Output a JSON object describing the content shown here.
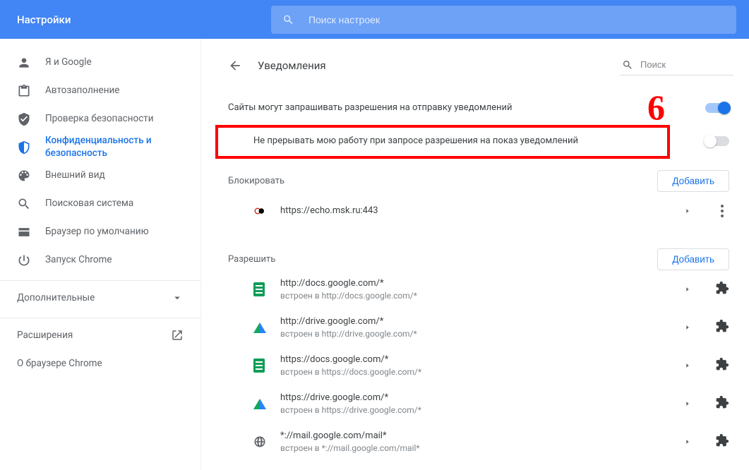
{
  "header": {
    "title": "Настройки",
    "search_placeholder": "Поиск настроек"
  },
  "sidebar": {
    "items": [
      {
        "label": "Я и Google"
      },
      {
        "label": "Автозаполнение"
      },
      {
        "label": "Проверка безопасности"
      },
      {
        "label": "Конфиденциальность и безопасность"
      },
      {
        "label": "Внешний вид"
      },
      {
        "label": "Поисковая система"
      },
      {
        "label": "Браузер по умолчанию"
      },
      {
        "label": "Запуск Chrome"
      }
    ],
    "advanced_label": "Дополнительные",
    "extensions_label": "Расширения",
    "about_label": "О браузере Chrome"
  },
  "page": {
    "title": "Уведомления",
    "search_placeholder": "Поиск",
    "annotation": "6",
    "toggle1_label": "Сайты могут запрашивать разрешения на отправку уведомлений",
    "toggle2_label": "Не прерывать мою работу при запросе разрешения на показ уведомлений"
  },
  "block": {
    "heading": "Блокировать",
    "add_label": "Добавить",
    "items": [
      {
        "url": "https://echo.msk.ru:443",
        "icon": "echo"
      }
    ]
  },
  "allow": {
    "heading": "Разрешить",
    "add_label": "Добавить",
    "items": [
      {
        "url": "http://docs.google.com/*",
        "sub": "встроен в http://docs.google.com/*",
        "icon": "docs"
      },
      {
        "url": "http://drive.google.com/*",
        "sub": "встроен в http://drive.google.com/*",
        "icon": "drive"
      },
      {
        "url": "https://docs.google.com/*",
        "sub": "встроен в https://docs.google.com/*",
        "icon": "docs"
      },
      {
        "url": "https://drive.google.com/*",
        "sub": "встроен в https://drive.google.com/*",
        "icon": "drive"
      },
      {
        "url": "*://mail.google.com/mail*",
        "sub": "встроен в *://mail.google.com/mail*",
        "icon": "globe"
      }
    ]
  }
}
